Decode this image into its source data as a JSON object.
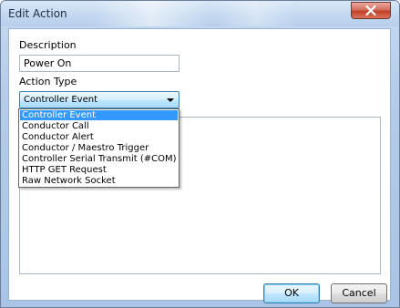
{
  "window": {
    "title": "Edit Action"
  },
  "description": {
    "label": "Description",
    "value": "Power On"
  },
  "action_type": {
    "label": "Action Type",
    "selected": "Controller Event",
    "options": [
      "Controller Event",
      "Conductor Call",
      "Conductor Alert",
      "Conductor / Maestro Trigger",
      "Controller Serial Transmit (#COM)",
      "HTTP GET Request",
      "Raw Network Socket"
    ]
  },
  "buttons": {
    "ok": "OK",
    "cancel": "Cancel"
  },
  "colors": {
    "selection": "#3399ff",
    "close_button": "#c0412a"
  }
}
